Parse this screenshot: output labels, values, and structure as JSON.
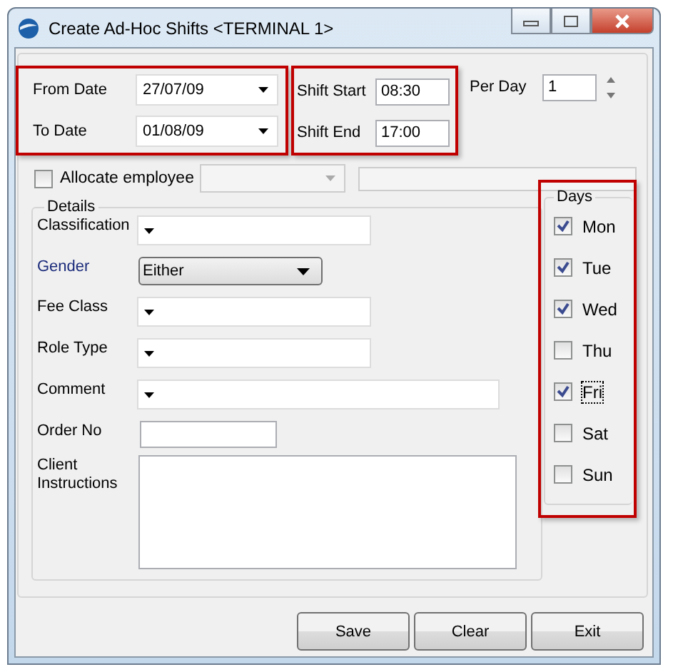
{
  "window": {
    "title": "Create Ad-Hoc Shifts <TERMINAL 1>"
  },
  "dates": [
    {
      "label": "From Date",
      "value": "27/07/09"
    },
    {
      "label": "To Date",
      "value": "01/08/09"
    }
  ],
  "shift": [
    {
      "label": "Shift Start",
      "value": "08:30"
    },
    {
      "label": "Shift End",
      "value": "17:00"
    }
  ],
  "per_day": {
    "label": "Per Day",
    "value": "1"
  },
  "allocate": {
    "label": "Allocate employee",
    "checked": false
  },
  "details": {
    "title": "Details",
    "fields": [
      {
        "kind": "combo",
        "label": "Classification",
        "emphasis": false,
        "wide": false
      },
      {
        "kind": "select",
        "label": "Gender",
        "emphasis": true,
        "value": "Either"
      },
      {
        "kind": "combo",
        "label": "Fee Class",
        "emphasis": false,
        "wide": false
      },
      {
        "kind": "combo",
        "label": "Role Type",
        "emphasis": false,
        "wide": false
      },
      {
        "kind": "combo",
        "label": "Comment",
        "emphasis": false,
        "wide": true
      },
      {
        "kind": "text",
        "label": "Order No",
        "emphasis": false
      },
      {
        "kind": "memo",
        "label": "Client Instructions",
        "emphasis": false
      }
    ]
  },
  "days": {
    "title": "Days",
    "items": [
      {
        "label": "Mon",
        "checked": true,
        "focused": false
      },
      {
        "label": "Tue",
        "checked": true,
        "focused": false
      },
      {
        "label": "Wed",
        "checked": true,
        "focused": false
      },
      {
        "label": "Thu",
        "checked": false,
        "focused": false
      },
      {
        "label": "Fri",
        "checked": true,
        "focused": true
      },
      {
        "label": "Sat",
        "checked": false,
        "focused": false
      },
      {
        "label": "Sun",
        "checked": false,
        "focused": false
      }
    ]
  },
  "buttons": [
    "Save",
    "Clear",
    "Exit"
  ]
}
